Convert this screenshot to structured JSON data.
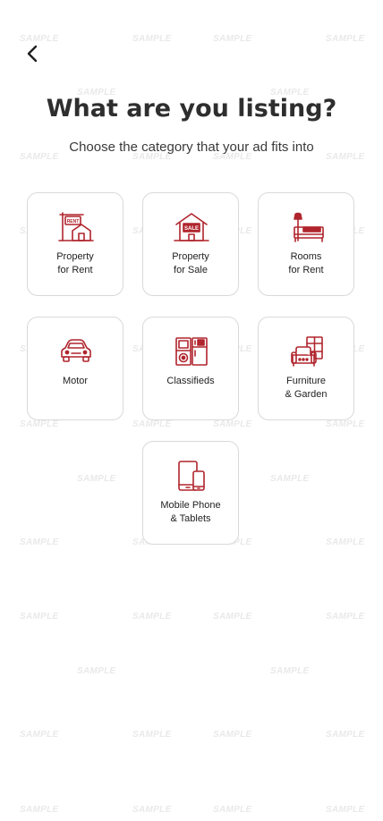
{
  "watermark": {
    "text": "SAMPLE"
  },
  "header": {
    "back_icon": "chevron-left-icon"
  },
  "title": "What are you listing?",
  "subtitle": "Choose the category that your ad fits into",
  "accent_color": "#b0252d",
  "categories": [
    {
      "label": "Property\nfor Rent",
      "icon": "house-rent-sign-icon",
      "sign_text": "RENT"
    },
    {
      "label": "Property\nfor Sale",
      "icon": "house-sale-icon",
      "sign_text": "SALE"
    },
    {
      "label": "Rooms\nfor Rent",
      "icon": "bed-lamp-icon"
    },
    {
      "label": "Motor",
      "icon": "car-icon"
    },
    {
      "label": "Classifieds",
      "icon": "appliances-icon"
    },
    {
      "label": "Furniture\n& Garden",
      "icon": "sofa-cabinet-icon"
    },
    {
      "label": "Mobile Phone\n& Tablets",
      "icon": "phone-tablet-icon"
    }
  ]
}
